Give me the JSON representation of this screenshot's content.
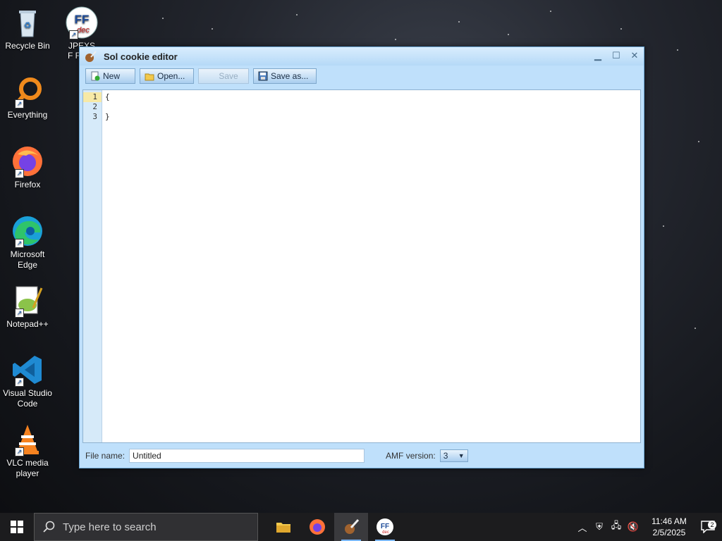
{
  "desktop": {
    "icons": [
      {
        "label": "Recycle Bin",
        "icon": "recycle-bin-icon"
      },
      {
        "label": "JPEXS F Flash",
        "icon": "ffdec-icon"
      },
      {
        "label": "Everything",
        "icon": "everything-search-icon"
      },
      {
        "label": "Firefox",
        "icon": "firefox-icon"
      },
      {
        "label": "Microsoft Edge",
        "icon": "edge-icon"
      },
      {
        "label": "Notepad++",
        "icon": "notepadpp-icon"
      },
      {
        "label": "Visual Studio Code",
        "icon": "vscode-icon"
      },
      {
        "label": "VLC media player",
        "icon": "vlc-icon"
      }
    ]
  },
  "window": {
    "title": "Sol cookie editor",
    "toolbar": {
      "new_label": "New",
      "open_label": "Open...",
      "save_label": "Save",
      "saveas_label": "Save as..."
    },
    "editor": {
      "line_numbers": [
        "1",
        "2",
        "3"
      ],
      "lines": [
        "{",
        "",
        "}"
      ],
      "current_line": 1
    },
    "footer": {
      "filename_label": "File name:",
      "filename_value": "Untitled",
      "amf_label": "AMF version:",
      "amf_value": "3"
    }
  },
  "taskbar": {
    "search_placeholder": "Type here to search",
    "apps": [
      "file-explorer-icon",
      "firefox-icon",
      "sol-editor-icon",
      "ffdec-icon"
    ],
    "clock_time": "11:46 AM",
    "clock_date": "2/5/2025",
    "notification_count": "2"
  },
  "colors": {
    "window_bg": "#bfe0fb",
    "taskbar_bg": "#1c1c1e",
    "current_line_bg": "#f7e9a6"
  }
}
